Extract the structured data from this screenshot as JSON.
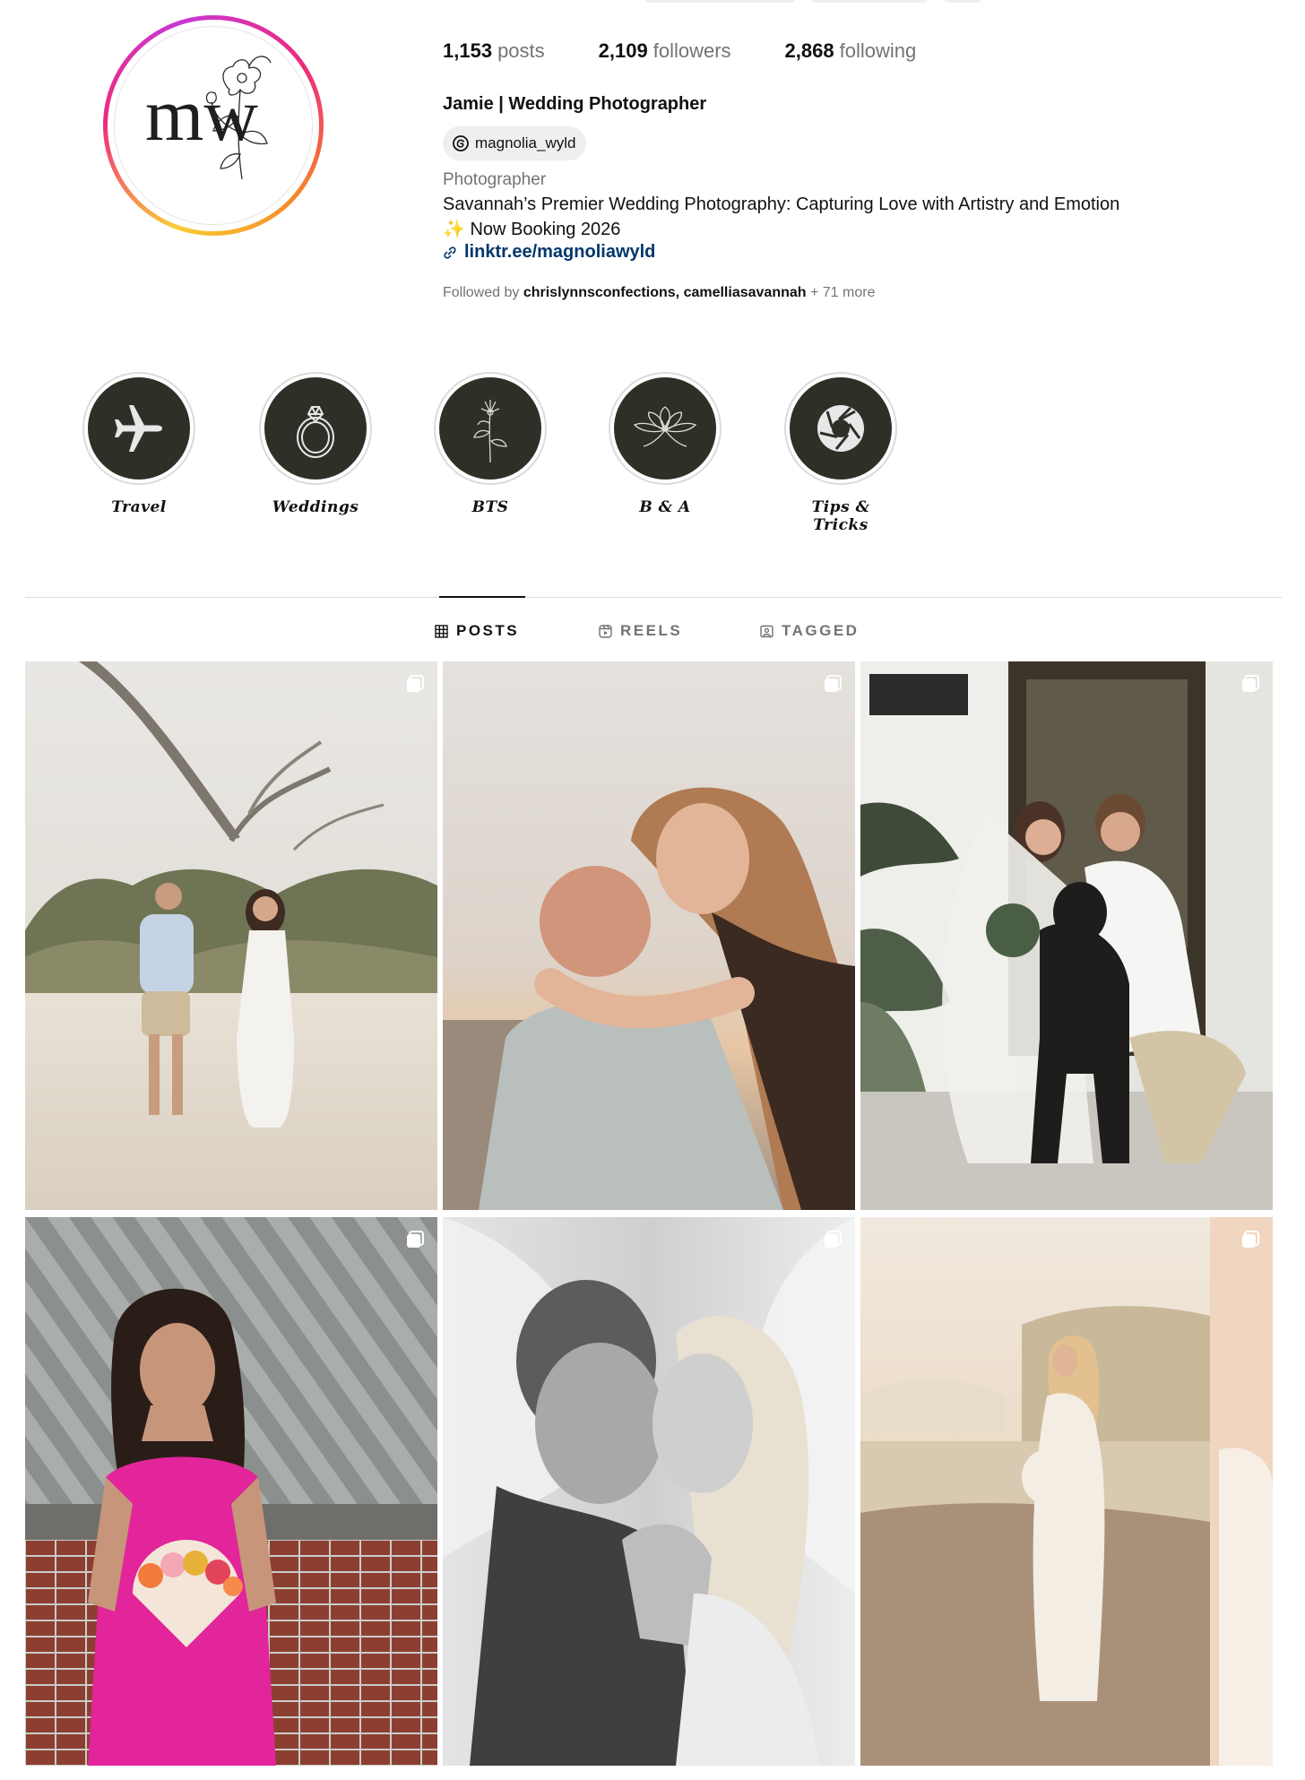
{
  "profile": {
    "stats": {
      "posts_count": "1,153",
      "posts_label": "posts",
      "followers_count": "2,109",
      "followers_label": "followers",
      "following_count": "2,868",
      "following_label": "following"
    },
    "full_name": "Jamie | Wedding Photographer",
    "threads_handle": "magnolia_wyld",
    "category": "Photographer",
    "bio_line1": "Savannah’s Premier Wedding Photography: Capturing Love with Artistry and Emotion",
    "bio_line2_emoji": "✨",
    "bio_line2_text": "Now Booking 2026",
    "link": "linktr.ee/magnoliawyld",
    "followed_by_prefix": "Followed by",
    "followed_by_user1": "chrislynnsconfections",
    "followed_by_sep": ",",
    "followed_by_user2": "camelliasavannah",
    "followed_by_more": "+ 71 more",
    "avatar_monogram": "mw"
  },
  "highlights": [
    {
      "label": "Travel",
      "icon": "airplane-icon"
    },
    {
      "label": "Weddings",
      "icon": "ring-icon"
    },
    {
      "label": "BTS",
      "icon": "flower-sprig-icon"
    },
    {
      "label": "B & A",
      "icon": "magnolia-icon"
    },
    {
      "label": "Tips & Tricks",
      "icon": "camera-aperture-icon"
    }
  ],
  "tabs": [
    {
      "label": "POSTS",
      "icon": "grid-icon",
      "active": true
    },
    {
      "label": "REELS",
      "icon": "reels-icon",
      "active": false
    },
    {
      "label": "TAGGED",
      "icon": "tagged-icon",
      "active": false
    }
  ],
  "posts": [
    {
      "subject": "couple walking on beach",
      "icon": "carousel-icon"
    },
    {
      "subject": "couple embracing at sunset",
      "icon": "carousel-icon"
    },
    {
      "subject": "bride, groom and dog on porch",
      "icon": "carousel-icon"
    },
    {
      "subject": "woman in pink dress with flower fan",
      "icon": "carousel-icon"
    },
    {
      "subject": "black and white couple kiss under veil",
      "icon": "carousel-icon"
    },
    {
      "subject": "maternity portrait on dunes",
      "icon": "carousel-icon"
    }
  ],
  "colors": {
    "highlight_disc": "#2c3027",
    "link": "#00376b",
    "muted_text": "#737373",
    "divider": "#dbdbdb"
  }
}
